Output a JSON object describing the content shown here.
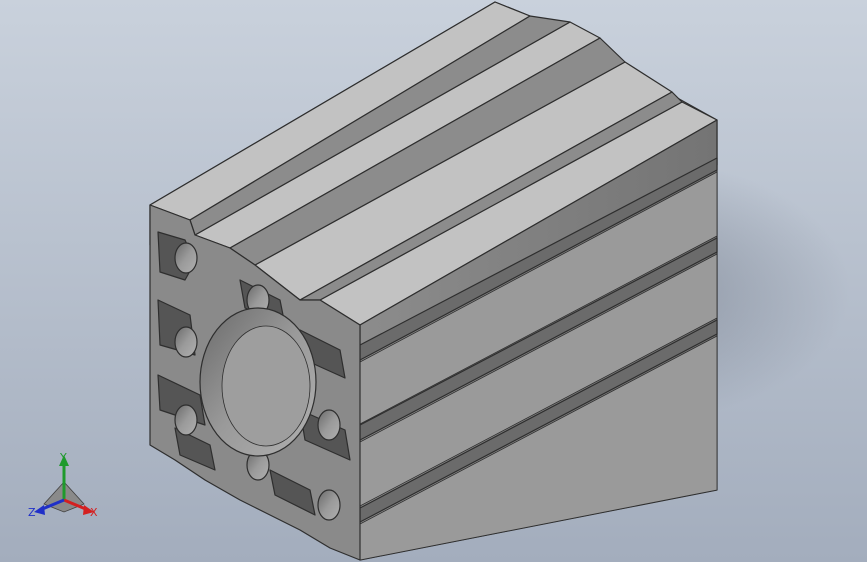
{
  "viewport": {
    "background_top": "#c9d1dc",
    "background_bottom": "#a5afbe"
  },
  "model": {
    "name": "aluminum-extrusion-profile",
    "face_color": "#8a8a8a",
    "top_color": "#b9b9b9",
    "side_color": "#7e7e7e",
    "edge_color": "#303030"
  },
  "triad": {
    "x_label": "X",
    "y_label": "Y",
    "z_label": "Z",
    "x_color": "#d42020",
    "y_color": "#1e9a2c",
    "z_color": "#2030c8"
  }
}
